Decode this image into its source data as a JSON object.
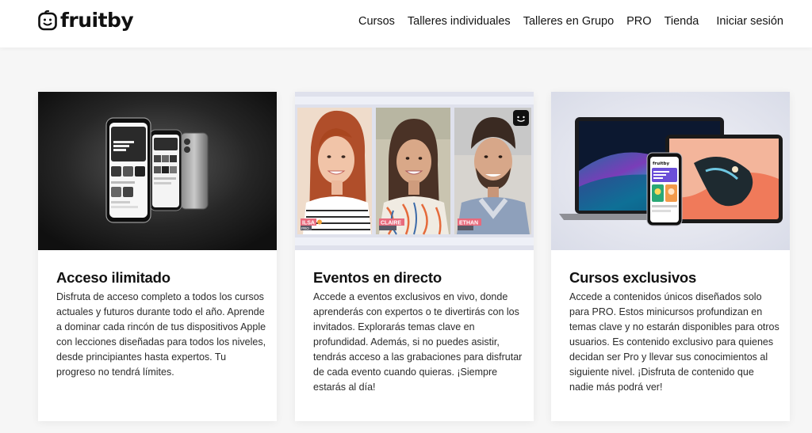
{
  "header": {
    "logo_text": "fruitby",
    "nav": [
      {
        "label": "Cursos"
      },
      {
        "label": "Talleres individuales"
      },
      {
        "label": "Talleres en Grupo"
      },
      {
        "label": "PRO"
      },
      {
        "label": "Tienda"
      }
    ],
    "login_label": "Iniciar sesión"
  },
  "cards": [
    {
      "title": "Acceso ilimitado",
      "body": "Disfruta de acceso completo a todos los cursos actuales y futuros durante todo el año. Aprende a dominar cada rincón de tus dispositivos Apple con lecciones diseñadas para todos los niveles, desde principiantes hasta expertos. Tu progreso no tendrá límites."
    },
    {
      "title": "Eventos en directo",
      "body": "Accede a eventos exclusivos en vivo, donde aprenderás con expertos o te divertirás con los invitados. Explorarás temas clave en profundidad. Además, si no puedes asistir, tendrás acceso a las grabaciones para disfrutar de cada evento cuando quieras. ¡Siempre estarás al día!",
      "people": [
        {
          "name": "ILSA",
          "role": "PRO"
        },
        {
          "name": "CLAIRE",
          "role": ""
        },
        {
          "name": "ETHAN",
          "role": ""
        }
      ]
    },
    {
      "title": "Cursos exclusivos",
      "body": "Accede a contenidos únicos diseñados solo para PRO. Estos minicursos profundizan en temas clave y no estarán disponibles para otros usuarios. Es contenido exclusivo para quienes decidan ser Pro y llevar sus conocimientos al siguiente nivel. ¡Disfruta de contenido que nadie más podrá ver!"
    }
  ],
  "colors": {
    "background": "#f6f6f6",
    "card": "#ffffff",
    "text": "#1a1a1a",
    "name_tag": "#e86a7c"
  }
}
